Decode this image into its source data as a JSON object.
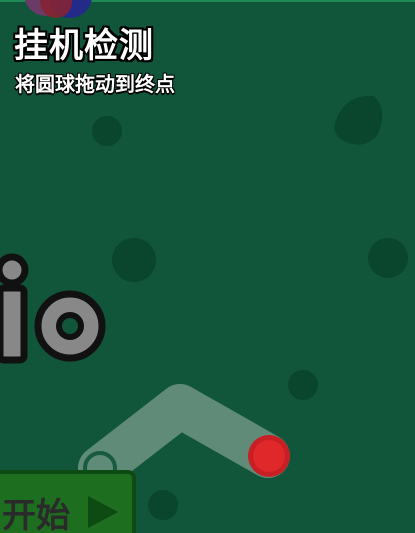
{
  "game": {
    "title": "挂机检测",
    "instruction": "将圆球拖动到终点",
    "start_button": {
      "label": "开始",
      "icon": "play-icon"
    },
    "drag_ball": {
      "icon": "red-ball-icon",
      "color": "#e0282b"
    },
    "target": {
      "icon": "target-ring-icon"
    },
    "colors": {
      "background": "#11553a",
      "path": "#7a9e8e",
      "ball": "#e0282b",
      "button": "#1d6e1f"
    }
  }
}
